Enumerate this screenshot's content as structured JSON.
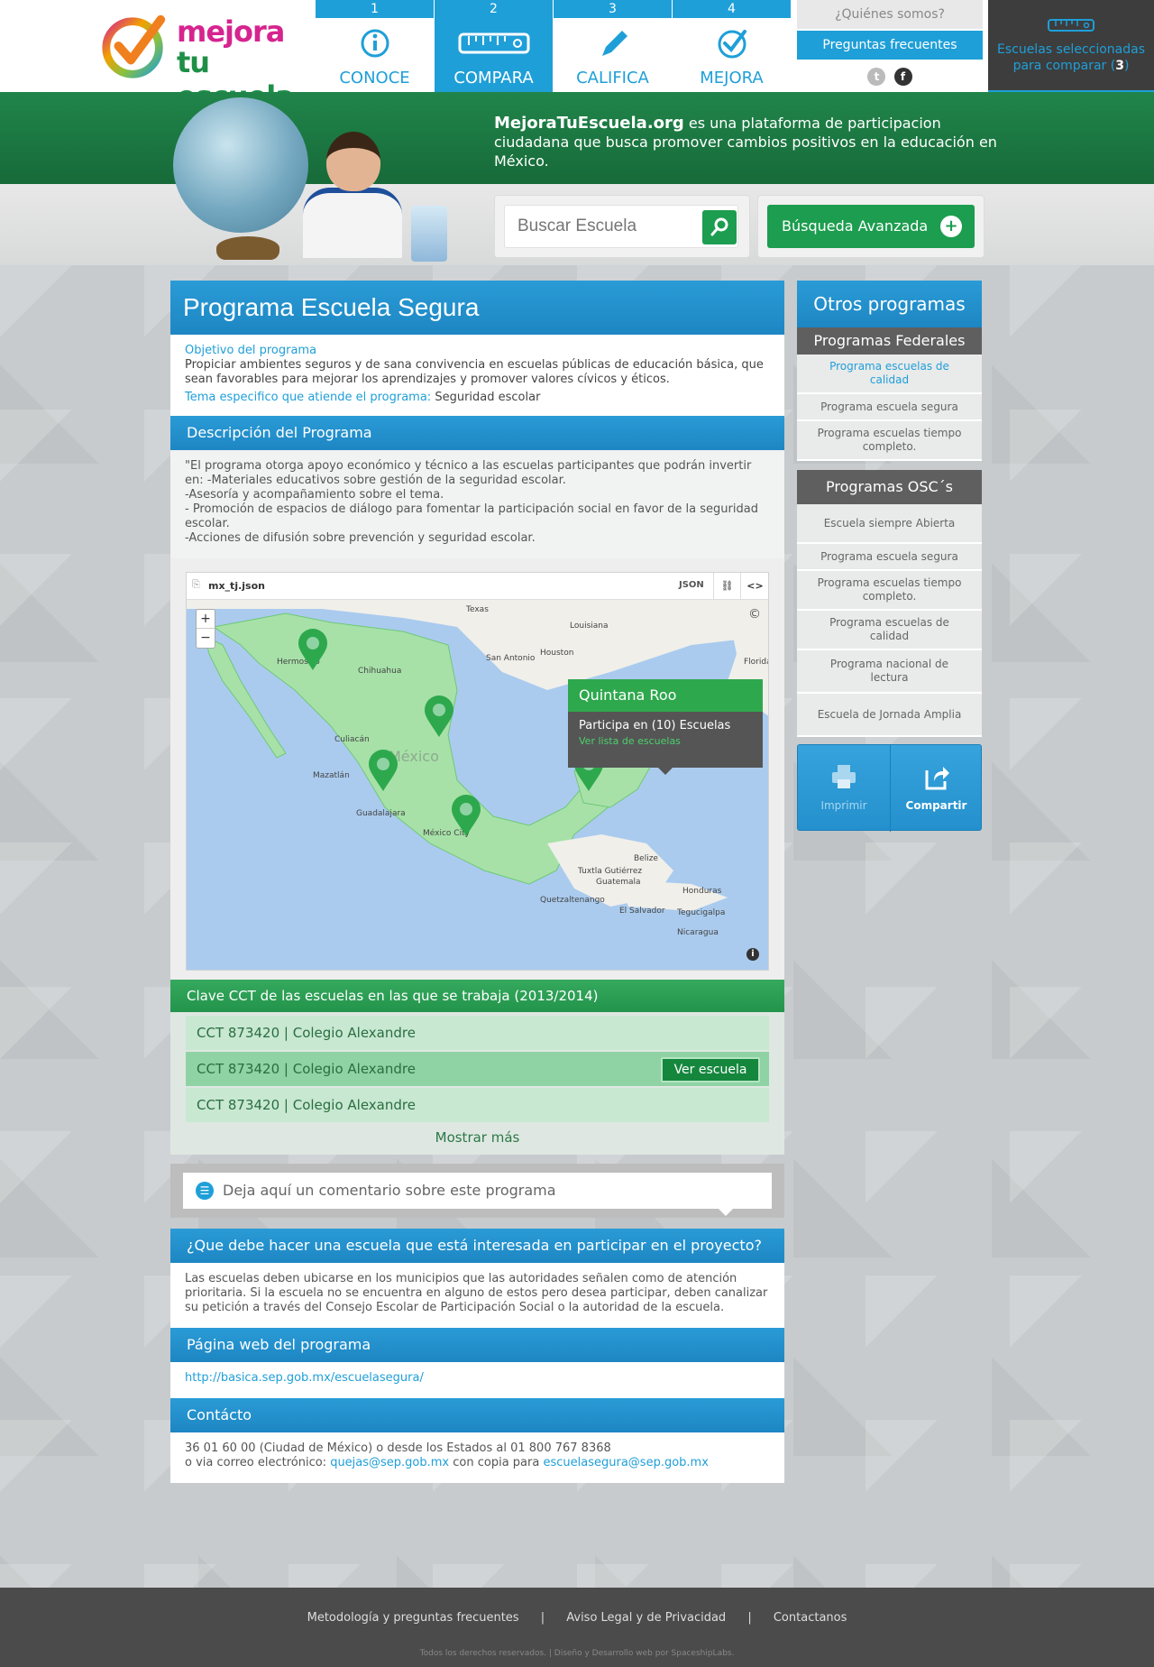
{
  "brand": {
    "line1": "mejora",
    "line2a": "tu",
    "line2b": "escuela"
  },
  "steps": [
    {
      "num": "1",
      "label": "CONOCE",
      "icon": "info-icon"
    },
    {
      "num": "2",
      "label": "COMPARA",
      "icon": "ruler-icon"
    },
    {
      "num": "3",
      "label": "CALIFICA",
      "icon": "pencil-icon"
    },
    {
      "num": "4",
      "label": "MEJORA",
      "icon": "check-icon"
    }
  ],
  "about": {
    "who": "¿Quiénes somos?",
    "faq": "Preguntas frecuentes"
  },
  "compare": {
    "label": "Escuelas seleccionadas para comparar (",
    "count": "3",
    "suffix": ")"
  },
  "hero": {
    "site": "MejoraTuEscuela.org",
    "tagline": " es una plataforma de participacion ciudadana que busca promover cambios positivos en la educación en México."
  },
  "search": {
    "placeholder": "Buscar Escuela",
    "advanced": "Búsqueda Avanzada"
  },
  "program": {
    "title": "Programa Escuela Segura",
    "objective_label": "Objetivo del programa",
    "objective": "Propiciar ambientes seguros y de sana convivencia en escuelas públicas de educación básica, que sean favorables para mejorar los aprendizajes y promover valores cívicos y éticos.",
    "theme_label": "Tema especifico que atiende el programa:",
    "theme": " Seguridad escolar"
  },
  "description": {
    "title": "Descripción del Programa",
    "lines": [
      "\"El programa otorga apoyo económico y técnico a las escuelas participantes que podrán invertir en: -Materiales educativos sobre gestión de la seguridad escolar.",
      "-Asesoría y acompañamiento sobre el tema.",
      "- Promoción de espacios de diálogo para fomentar la participación social en favor de la seguridad escolar.",
      "-Acciones de difusión sobre prevención y seguridad escolar."
    ]
  },
  "map": {
    "file": "mx_tj.json",
    "json": "JSON",
    "labels": [
      "Texas",
      "Louisiana",
      "Hermosillo",
      "Chihuahua",
      "San Antonio",
      "Houston",
      "Florida",
      "Culiacán",
      "México",
      "Mazatlán",
      "Guadalajara",
      "México City",
      "Belize",
      "Tuxtla Gutiérrez",
      "Guatemala",
      "Honduras",
      "Quetzaltenango",
      "El Salvador",
      "Tegucigalpa",
      "Nicaragua"
    ],
    "popup": {
      "state": "Quintana Roo",
      "count": "Participa en (10) Escuelas",
      "link": "Ver lista de escuelas"
    }
  },
  "cct": {
    "title": "Clave CCT de las escuelas en las que se trabaja (2013/2014)",
    "rows": [
      "CCT 873420 | Colegio Alexandre",
      "CCT 873420 | Colegio Alexandre",
      "CCT 873420 | Colegio Alexandre"
    ],
    "view_button": "Ver escuela",
    "more": "Mostrar más"
  },
  "comment": {
    "placeholder": "Deja aquí un comentario sobre este programa"
  },
  "participate": {
    "title": "¿Que debe hacer una escuela que está interesada en participar en el proyecto?",
    "text": "Las escuelas deben ubicarse en los municipios que las autoridades señalen como de atención prioritaria.  Si la escuela no se encuentra en alguno de estos pero desea participar, deben canalizar su petición a través del Consejo Escolar de Participación Social o la autoridad de la escuela."
  },
  "website": {
    "title": "Página web del programa",
    "url": "http://basica.sep.gob.mx/escuelasegura/"
  },
  "contact": {
    "title": "Contácto",
    "line1": "36 01 60 00 (Ciudad de México) o desde los Estados al 01 800 767 8368",
    "line2a": "o  via correo electrónico:  ",
    "email1": "quejas@sep.gob.mx",
    "line2b": " con copia para ",
    "email2": "escuelasegura@sep.gob.mx"
  },
  "sidebar": {
    "title": "Otros programas",
    "federal_title": "Programas Federales",
    "federal": [
      "Programa escuelas de calidad",
      "Programa escuela segura",
      "Programa escuelas tiempo completo."
    ],
    "osc_title": "Programas OSC´s",
    "osc": [
      "Escuela siempre Abierta",
      "Programa escuela segura",
      "Programa escuelas tiempo completo.",
      "Programa escuelas de calidad",
      "Programa nacional de lectura",
      "Escuela de Jornada Amplia"
    ],
    "print": "Imprimir",
    "share": "Compartir"
  },
  "footer": {
    "links": [
      "Metodología y preguntas frecuentes",
      "|",
      "Aviso Legal  y  de Privacidad",
      "|",
      "Contactanos"
    ],
    "copy": "Todos los derechos reservados. | Diseño y Desarrollo web por SpaceshipLabs."
  },
  "colors": {
    "brand_blue": "#1f9fd8",
    "brand_green": "#1d9d4f",
    "dark": "#3d3d3d"
  }
}
